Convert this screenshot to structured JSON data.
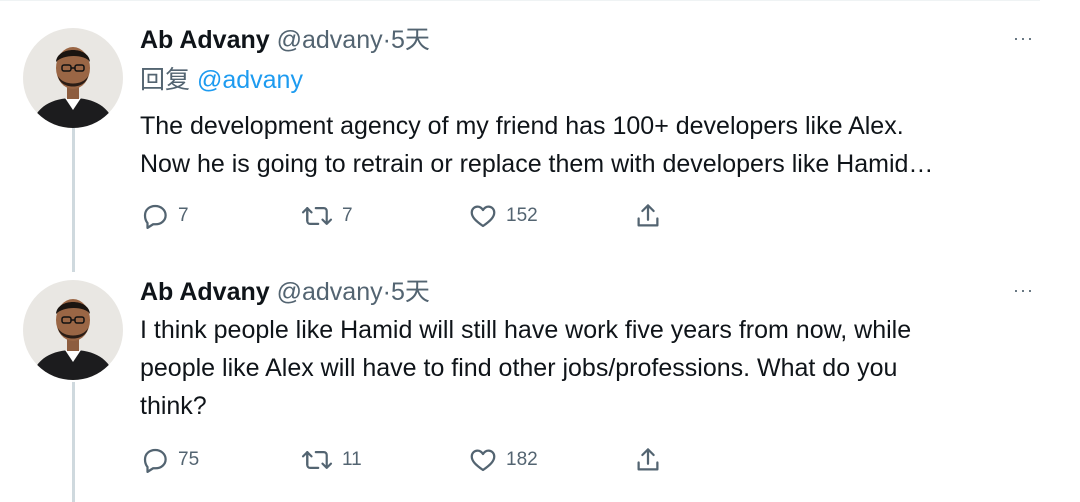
{
  "tweets": [
    {
      "name": "Ab Advany",
      "handle": "@advany",
      "separator": "·",
      "time": "5天",
      "reply_prefix": "回复",
      "reply_mention": "@advany",
      "text_lines": [
        "The development agency of my friend has 100+ developers like Alex.",
        "Now he is going to retrain or replace them with developers like Hamid…"
      ],
      "replies": "7",
      "retweets": "7",
      "likes": "152",
      "more": "···"
    },
    {
      "name": "Ab Advany",
      "handle": "@advany",
      "separator": "·",
      "time": "5天",
      "text_lines": [
        "I think people like Hamid will still have work five years from now, while",
        "people like Alex will have to find other jobs/professions. What do you",
        "think?"
      ],
      "replies": "75",
      "retweets": "11",
      "likes": "182",
      "more": "···"
    }
  ],
  "icons": {
    "reply": "reply-bubble-icon",
    "retweet": "retweet-icon",
    "like": "heart-icon",
    "share": "share-upload-icon",
    "more": "more-dots-icon"
  },
  "colors": {
    "text": "#0f1419",
    "secondary": "#536471",
    "link": "#1d9bf0",
    "thread_line": "#cfd9de"
  }
}
